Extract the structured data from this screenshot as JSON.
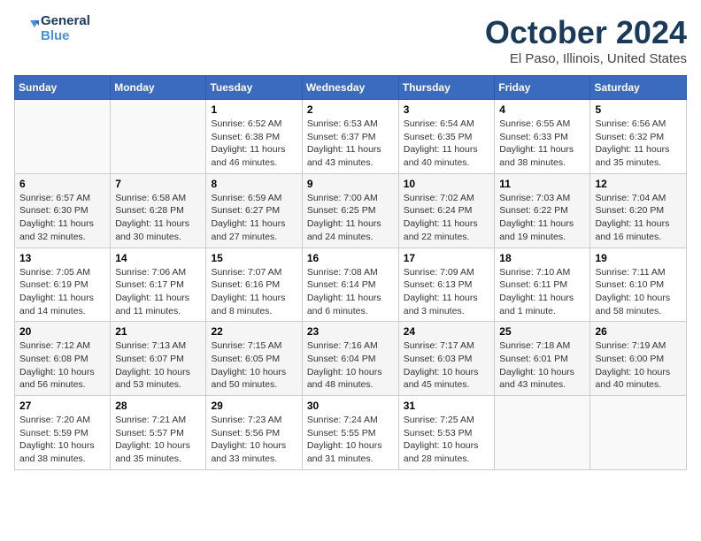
{
  "header": {
    "logo_line1": "General",
    "logo_line2": "Blue",
    "month_title": "October 2024",
    "location": "El Paso, Illinois, United States"
  },
  "weekdays": [
    "Sunday",
    "Monday",
    "Tuesday",
    "Wednesday",
    "Thursday",
    "Friday",
    "Saturday"
  ],
  "weeks": [
    [
      {
        "day": "",
        "info": ""
      },
      {
        "day": "",
        "info": ""
      },
      {
        "day": "1",
        "info": "Sunrise: 6:52 AM\nSunset: 6:38 PM\nDaylight: 11 hours and 46 minutes."
      },
      {
        "day": "2",
        "info": "Sunrise: 6:53 AM\nSunset: 6:37 PM\nDaylight: 11 hours and 43 minutes."
      },
      {
        "day": "3",
        "info": "Sunrise: 6:54 AM\nSunset: 6:35 PM\nDaylight: 11 hours and 40 minutes."
      },
      {
        "day": "4",
        "info": "Sunrise: 6:55 AM\nSunset: 6:33 PM\nDaylight: 11 hours and 38 minutes."
      },
      {
        "day": "5",
        "info": "Sunrise: 6:56 AM\nSunset: 6:32 PM\nDaylight: 11 hours and 35 minutes."
      }
    ],
    [
      {
        "day": "6",
        "info": "Sunrise: 6:57 AM\nSunset: 6:30 PM\nDaylight: 11 hours and 32 minutes."
      },
      {
        "day": "7",
        "info": "Sunrise: 6:58 AM\nSunset: 6:28 PM\nDaylight: 11 hours and 30 minutes."
      },
      {
        "day": "8",
        "info": "Sunrise: 6:59 AM\nSunset: 6:27 PM\nDaylight: 11 hours and 27 minutes."
      },
      {
        "day": "9",
        "info": "Sunrise: 7:00 AM\nSunset: 6:25 PM\nDaylight: 11 hours and 24 minutes."
      },
      {
        "day": "10",
        "info": "Sunrise: 7:02 AM\nSunset: 6:24 PM\nDaylight: 11 hours and 22 minutes."
      },
      {
        "day": "11",
        "info": "Sunrise: 7:03 AM\nSunset: 6:22 PM\nDaylight: 11 hours and 19 minutes."
      },
      {
        "day": "12",
        "info": "Sunrise: 7:04 AM\nSunset: 6:20 PM\nDaylight: 11 hours and 16 minutes."
      }
    ],
    [
      {
        "day": "13",
        "info": "Sunrise: 7:05 AM\nSunset: 6:19 PM\nDaylight: 11 hours and 14 minutes."
      },
      {
        "day": "14",
        "info": "Sunrise: 7:06 AM\nSunset: 6:17 PM\nDaylight: 11 hours and 11 minutes."
      },
      {
        "day": "15",
        "info": "Sunrise: 7:07 AM\nSunset: 6:16 PM\nDaylight: 11 hours and 8 minutes."
      },
      {
        "day": "16",
        "info": "Sunrise: 7:08 AM\nSunset: 6:14 PM\nDaylight: 11 hours and 6 minutes."
      },
      {
        "day": "17",
        "info": "Sunrise: 7:09 AM\nSunset: 6:13 PM\nDaylight: 11 hours and 3 minutes."
      },
      {
        "day": "18",
        "info": "Sunrise: 7:10 AM\nSunset: 6:11 PM\nDaylight: 11 hours and 1 minute."
      },
      {
        "day": "19",
        "info": "Sunrise: 7:11 AM\nSunset: 6:10 PM\nDaylight: 10 hours and 58 minutes."
      }
    ],
    [
      {
        "day": "20",
        "info": "Sunrise: 7:12 AM\nSunset: 6:08 PM\nDaylight: 10 hours and 56 minutes."
      },
      {
        "day": "21",
        "info": "Sunrise: 7:13 AM\nSunset: 6:07 PM\nDaylight: 10 hours and 53 minutes."
      },
      {
        "day": "22",
        "info": "Sunrise: 7:15 AM\nSunset: 6:05 PM\nDaylight: 10 hours and 50 minutes."
      },
      {
        "day": "23",
        "info": "Sunrise: 7:16 AM\nSunset: 6:04 PM\nDaylight: 10 hours and 48 minutes."
      },
      {
        "day": "24",
        "info": "Sunrise: 7:17 AM\nSunset: 6:03 PM\nDaylight: 10 hours and 45 minutes."
      },
      {
        "day": "25",
        "info": "Sunrise: 7:18 AM\nSunset: 6:01 PM\nDaylight: 10 hours and 43 minutes."
      },
      {
        "day": "26",
        "info": "Sunrise: 7:19 AM\nSunset: 6:00 PM\nDaylight: 10 hours and 40 minutes."
      }
    ],
    [
      {
        "day": "27",
        "info": "Sunrise: 7:20 AM\nSunset: 5:59 PM\nDaylight: 10 hours and 38 minutes."
      },
      {
        "day": "28",
        "info": "Sunrise: 7:21 AM\nSunset: 5:57 PM\nDaylight: 10 hours and 35 minutes."
      },
      {
        "day": "29",
        "info": "Sunrise: 7:23 AM\nSunset: 5:56 PM\nDaylight: 10 hours and 33 minutes."
      },
      {
        "day": "30",
        "info": "Sunrise: 7:24 AM\nSunset: 5:55 PM\nDaylight: 10 hours and 31 minutes."
      },
      {
        "day": "31",
        "info": "Sunrise: 7:25 AM\nSunset: 5:53 PM\nDaylight: 10 hours and 28 minutes."
      },
      {
        "day": "",
        "info": ""
      },
      {
        "day": "",
        "info": ""
      }
    ]
  ]
}
